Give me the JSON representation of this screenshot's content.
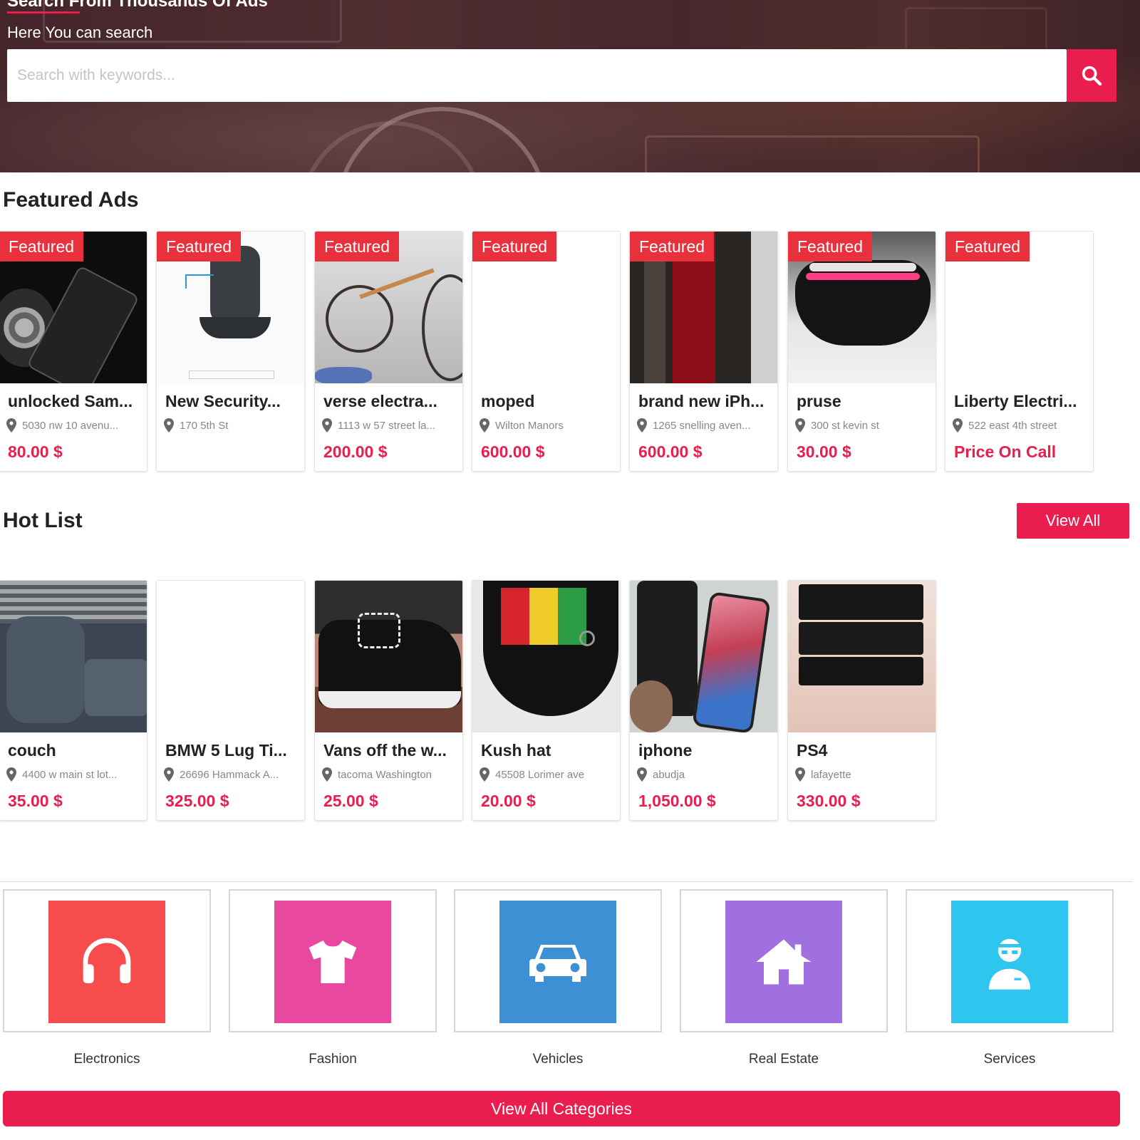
{
  "hero": {
    "title": "Search From Thousands Of Ads",
    "subtitle": "Here You can search",
    "search_placeholder": "Search with keywords..."
  },
  "featured": {
    "heading": "Featured Ads",
    "badge_label": "Featured",
    "items": [
      {
        "title": "unlocked Sam...",
        "location": "5030 nw 10 avenu...",
        "price": "80.00 $",
        "image": "phone-photo"
      },
      {
        "title": "New Security...",
        "location": "170 5th St",
        "price": "",
        "image": "security-camera-photo"
      },
      {
        "title": "verse electra...",
        "location": "1113 w 57 street la...",
        "price": "200.00 $",
        "image": "bicycle-photo"
      },
      {
        "title": "moped",
        "location": "Wilton Manors",
        "price": "600.00 $",
        "image": "blank"
      },
      {
        "title": "brand new iPh...",
        "location": "1265 snelling aven...",
        "price": "600.00 $",
        "image": "red-iphone-photo"
      },
      {
        "title": "pruse",
        "location": "300 st kevin st",
        "price": "30.00 $",
        "image": "purse-photo"
      },
      {
        "title": "Liberty Electri...",
        "location": "522 east 4th street",
        "price": "Price On Call",
        "image": "blank"
      }
    ]
  },
  "hotlist": {
    "heading": "Hot List",
    "view_all_label": "View All",
    "items": [
      {
        "title": "couch",
        "location": "4400 w main st lot...",
        "price": "35.00 $",
        "image": "couch-photo"
      },
      {
        "title": "BMW 5 Lug Ti...",
        "location": "26696 Hammack A...",
        "price": "325.00 $",
        "image": "blank"
      },
      {
        "title": "Vans off the w...",
        "location": "tacoma Washington",
        "price": "25.00 $",
        "image": "sneaker-photo"
      },
      {
        "title": "Kush hat",
        "location": "45508 Lorimer ave",
        "price": "20.00 $",
        "image": "hat-photo"
      },
      {
        "title": "iphone",
        "location": "abudja",
        "price": "1,050.00 $",
        "image": "iphone-x-photo"
      },
      {
        "title": "PS4",
        "location": "lafayette",
        "price": "330.00 $",
        "image": "ps4-photo"
      }
    ]
  },
  "categories": {
    "items": [
      {
        "label": "Electronics",
        "color": "#f64c4c",
        "icon": "headphones-icon"
      },
      {
        "label": "Fashion",
        "color": "#e8489e",
        "icon": "tshirt-icon"
      },
      {
        "label": "Vehicles",
        "color": "#3d90d3",
        "icon": "car-icon"
      },
      {
        "label": "Real Estate",
        "color": "#a06fe0",
        "icon": "house-icon"
      },
      {
        "label": "Services",
        "color": "#2ec5ef",
        "icon": "serviceman-icon"
      }
    ],
    "view_all_label": "View All Categories"
  },
  "colors": {
    "accent": "#ea1d4f",
    "badge": "#e8313c"
  }
}
